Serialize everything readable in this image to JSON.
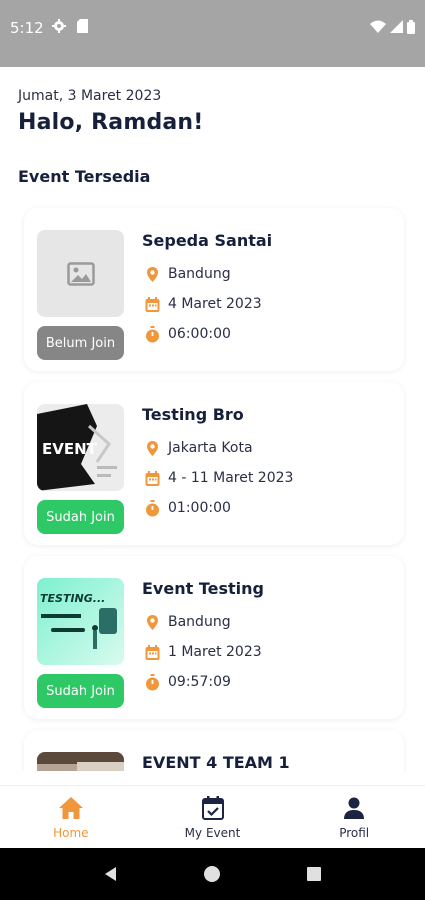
{
  "status_bar": {
    "time": "5:12"
  },
  "header": {
    "date": "Jumat, 3 Maret 2023",
    "greeting": "Halo, Ramdan!"
  },
  "section_title": "Event Tersedia",
  "events": [
    {
      "title": "Sepeda Santai",
      "location": "Bandung",
      "date": "4 Maret 2023",
      "time": "06:00:00",
      "status": "Belum Join"
    },
    {
      "title": "Testing Bro",
      "location": "Jakarta Kota",
      "date": "4 - 11 Maret 2023",
      "time": "01:00:00",
      "status": "Sudah Join"
    },
    {
      "title": "Event Testing",
      "location": "Bandung",
      "date": "1 Maret 2023",
      "time": "09:57:09",
      "status": "Sudah Join"
    },
    {
      "title": "EVENT 4 TEAM 1"
    }
  ],
  "thumb_texts": {
    "event_poster": "EVENT",
    "testing_banner": "TESTING..."
  },
  "bottom_nav": {
    "home": "Home",
    "my_event": "My Event",
    "profil": "Profil"
  },
  "colors": {
    "accent": "#f0973c",
    "joined": "#2ec866",
    "not_joined": "#868686",
    "status_bar": "#a5a5a5"
  }
}
